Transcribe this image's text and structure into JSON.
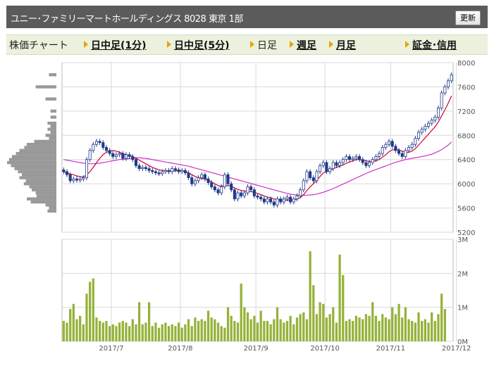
{
  "header": {
    "title": "ユニー･ファミリーマートホールディングス 8028 東京 1部",
    "refresh_label": "更新"
  },
  "tabs": [
    {
      "label": "株価チャート",
      "link": false,
      "arrow": false
    },
    {
      "label": "日中足(1分)",
      "link": true,
      "arrow": true
    },
    {
      "label": "日中足(5分)",
      "link": true,
      "arrow": true
    },
    {
      "label": "日足",
      "link": false,
      "arrow": true
    },
    {
      "label": "週足",
      "link": true,
      "arrow": true
    },
    {
      "label": "月足",
      "link": true,
      "arrow": true
    },
    {
      "label": "証金･信用",
      "link": true,
      "arrow": true
    }
  ],
  "colors": {
    "up_candle": "#ffffff",
    "down_candle": "#1f3a8a",
    "ma_short": "#cc0033",
    "ma_long": "#cc33cc",
    "volume": "#95b23a",
    "profile": "#999999",
    "grid": "#d9d9d9"
  },
  "chart_data": [
    {
      "type": "candlestick",
      "yticks": [
        5200,
        5600,
        6000,
        6400,
        6800,
        7200,
        7600,
        8000
      ],
      "ylim": [
        5200,
        8000
      ],
      "x_ticks": [
        {
          "label": "2017/7",
          "index": 15
        },
        {
          "label": "2017/8",
          "index": 36
        },
        {
          "label": "2017/9",
          "index": 59
        },
        {
          "label": "2017/10",
          "index": 80
        },
        {
          "label": "2017/11",
          "index": 100
        },
        {
          "label": "2017/12",
          "index": 120
        }
      ],
      "closes": [
        6200,
        6150,
        6050,
        6080,
        6060,
        6080,
        6100,
        6400,
        6550,
        6650,
        6700,
        6680,
        6600,
        6550,
        6500,
        6450,
        6480,
        6500,
        6420,
        6480,
        6450,
        6400,
        6300,
        6250,
        6270,
        6250,
        6220,
        6200,
        6180,
        6170,
        6200,
        6220,
        6200,
        6250,
        6230,
        6200,
        6220,
        6180,
        6100,
        6000,
        6050,
        6100,
        6150,
        6080,
        6020,
        5950,
        5900,
        5850,
        5950,
        6150,
        6000,
        5900,
        5750,
        5850,
        5800,
        5850,
        5950,
        5900,
        5800,
        5780,
        5750,
        5700,
        5750,
        5700,
        5650,
        5750,
        5700,
        5750,
        5780,
        5700,
        5750,
        5800,
        5900,
        6050,
        6200,
        6100,
        6050,
        6200,
        6300,
        6350,
        6200,
        6250,
        6350,
        6300,
        6350,
        6400,
        6450,
        6400,
        6420,
        6450,
        6400,
        6350,
        6300,
        6350,
        6400,
        6450,
        6500,
        6600,
        6650,
        6700,
        6620,
        6550,
        6500,
        6450,
        6550,
        6600,
        6650,
        6750,
        6850,
        6900,
        6950,
        7000,
        7050,
        7100,
        7250,
        7500,
        7600,
        7700,
        7800
      ],
      "ma_short": [
        6200,
        6180,
        6160,
        6150,
        6130,
        6120,
        6110,
        6150,
        6200,
        6270,
        6350,
        6420,
        6480,
        6520,
        6540,
        6550,
        6540,
        6520,
        6500,
        6480,
        6470,
        6450,
        6420,
        6390,
        6360,
        6330,
        6300,
        6270,
        6250,
        6230,
        6220,
        6215,
        6210,
        6210,
        6215,
        6220,
        6215,
        6200,
        6180,
        6150,
        6120,
        6100,
        6090,
        6080,
        6060,
        6030,
        6000,
        5970,
        5960,
        5970,
        5970,
        5960,
        5930,
        5910,
        5890,
        5880,
        5880,
        5870,
        5860,
        5840,
        5820,
        5800,
        5780,
        5770,
        5750,
        5740,
        5735,
        5730,
        5730,
        5730,
        5735,
        5745,
        5770,
        5820,
        5890,
        5950,
        6000,
        6060,
        6120,
        6180,
        6200,
        6220,
        6250,
        6270,
        6290,
        6310,
        6340,
        6360,
        6380,
        6400,
        6400,
        6390,
        6380,
        6370,
        6370,
        6380,
        6400,
        6440,
        6480,
        6530,
        6560,
        6570,
        6560,
        6540,
        6520,
        6520,
        6540,
        6580,
        6640,
        6700,
        6760,
        6820,
        6880,
        6940,
        7020,
        7120,
        7220,
        7330,
        7450
      ],
      "ma_long": [
        6400,
        6390,
        6380,
        6370,
        6360,
        6350,
        6340,
        6335,
        6330,
        6330,
        6335,
        6340,
        6350,
        6360,
        6370,
        6380,
        6390,
        6400,
        6405,
        6410,
        6415,
        6420,
        6425,
        6430,
        6425,
        6420,
        6410,
        6400,
        6390,
        6380,
        6370,
        6360,
        6350,
        6340,
        6330,
        6320,
        6310,
        6300,
        6290,
        6275,
        6260,
        6245,
        6230,
        6215,
        6200,
        6185,
        6170,
        6155,
        6140,
        6125,
        6110,
        6095,
        6080,
        6065,
        6050,
        6035,
        6020,
        6005,
        5990,
        5975,
        5960,
        5945,
        5930,
        5915,
        5900,
        5885,
        5870,
        5855,
        5840,
        5830,
        5820,
        5815,
        5812,
        5810,
        5812,
        5815,
        5820,
        5830,
        5845,
        5860,
        5880,
        5900,
        5920,
        5945,
        5970,
        5995,
        6020,
        6045,
        6070,
        6095,
        6120,
        6145,
        6170,
        6195,
        6215,
        6235,
        6255,
        6275,
        6295,
        6315,
        6335,
        6355,
        6370,
        6385,
        6400,
        6410,
        6420,
        6430,
        6440,
        6450,
        6460,
        6475,
        6490,
        6510,
        6535,
        6565,
        6600,
        6640,
        6690
      ]
    },
    {
      "type": "bar",
      "title": "volume",
      "yticks": [
        {
          "label": "0M",
          "value": 0
        },
        {
          "label": "1M",
          "value": 1000000
        },
        {
          "label": "2M",
          "value": 2000000
        },
        {
          "label": "3M",
          "value": 3000000
        }
      ],
      "ylim": [
        0,
        3000000
      ],
      "values": [
        600000,
        550000,
        950000,
        1100000,
        650000,
        750000,
        500000,
        1400000,
        1750000,
        1850000,
        700000,
        600000,
        550000,
        600000,
        450000,
        500000,
        450000,
        550000,
        600000,
        550000,
        450000,
        650000,
        500000,
        1150000,
        500000,
        550000,
        1150000,
        450000,
        550000,
        400000,
        500000,
        550000,
        450000,
        500000,
        450000,
        550000,
        400000,
        500000,
        650000,
        450000,
        700000,
        600000,
        650000,
        600000,
        900000,
        700000,
        650000,
        550000,
        450000,
        400000,
        1000000,
        750000,
        600000,
        550000,
        1700000,
        1000000,
        850000,
        650000,
        750000,
        550000,
        900000,
        600000,
        600000,
        500000,
        650000,
        1000000,
        650000,
        550000,
        600000,
        750000,
        500000,
        700000,
        800000,
        850000,
        650000,
        2650000,
        1650000,
        800000,
        1150000,
        1100000,
        700000,
        800000,
        1000000,
        550000,
        2550000,
        1950000,
        600000,
        650000,
        600000,
        750000,
        700000,
        650000,
        800000,
        750000,
        1150000,
        750000,
        600000,
        800000,
        700000,
        650000,
        1000000,
        800000,
        1100000,
        700000,
        1000000,
        650000,
        600000,
        550000,
        850000,
        600000,
        650000,
        550000,
        850000,
        600000,
        800000,
        1400000,
        950000
      ]
    }
  ],
  "price_profile": [
    {
      "price": 7800,
      "vol": 0.15
    },
    {
      "price": 7600,
      "vol": 0.42
    },
    {
      "price": 7400,
      "vol": 0.22
    },
    {
      "price": 7200,
      "vol": 0.12
    },
    {
      "price": 7100,
      "vol": 0.12
    },
    {
      "price": 7000,
      "vol": 0.18
    },
    {
      "price": 6950,
      "vol": 0.12
    },
    {
      "price": 6900,
      "vol": 0.18
    },
    {
      "price": 6850,
      "vol": 0.12
    },
    {
      "price": 6800,
      "vol": 0.22
    },
    {
      "price": 6750,
      "vol": 0.15
    },
    {
      "price": 6700,
      "vol": 0.45
    },
    {
      "price": 6650,
      "vol": 0.6
    },
    {
      "price": 6600,
      "vol": 0.65
    },
    {
      "price": 6550,
      "vol": 0.75
    },
    {
      "price": 6500,
      "vol": 0.82
    },
    {
      "price": 6450,
      "vol": 0.9
    },
    {
      "price": 6400,
      "vol": 0.96
    },
    {
      "price": 6350,
      "vol": 1.0
    },
    {
      "price": 6300,
      "vol": 0.92
    },
    {
      "price": 6250,
      "vol": 0.85
    },
    {
      "price": 6200,
      "vol": 0.78
    },
    {
      "price": 6150,
      "vol": 0.7
    },
    {
      "price": 6100,
      "vol": 0.75
    },
    {
      "price": 6050,
      "vol": 0.62
    },
    {
      "price": 6000,
      "vol": 0.66
    },
    {
      "price": 5950,
      "vol": 0.55
    },
    {
      "price": 5900,
      "vol": 0.5
    },
    {
      "price": 5850,
      "vol": 0.42
    },
    {
      "price": 5800,
      "vol": 0.4
    },
    {
      "price": 5750,
      "vol": 0.6
    },
    {
      "price": 5700,
      "vol": 0.52
    },
    {
      "price": 5650,
      "vol": 0.22
    },
    {
      "price": 5600,
      "vol": 0.15
    },
    {
      "price": 5550,
      "vol": 0.18
    }
  ]
}
